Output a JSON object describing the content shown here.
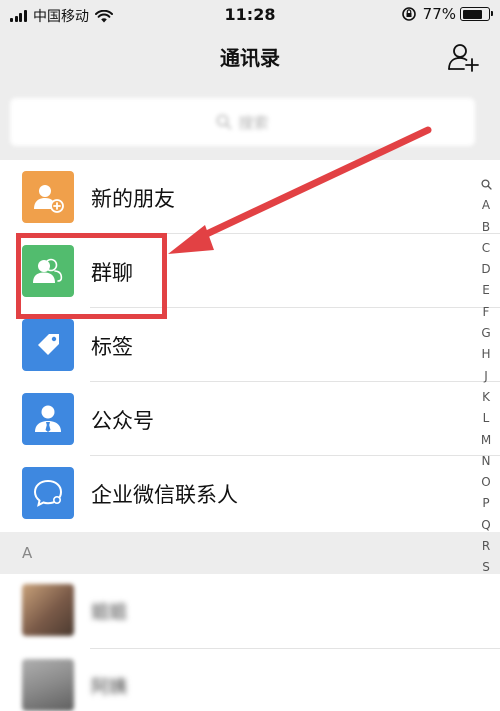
{
  "status_bar": {
    "carrier": "中国移动",
    "time": "11:28",
    "battery_text": "77%",
    "battery_level": 0.77
  },
  "nav": {
    "title": "通讯录",
    "add_icon": "add-contact-icon"
  },
  "search": {
    "placeholder": "搜索",
    "icon": "search-icon"
  },
  "menu_items": [
    {
      "label": "新的朋友",
      "icon": "new-friend-icon",
      "color": "#f0a04b"
    },
    {
      "label": "群聊",
      "icon": "group-chat-icon",
      "color": "#52bc6e"
    },
    {
      "label": "标签",
      "icon": "tag-icon",
      "color": "#3e88e0"
    },
    {
      "label": "公众号",
      "icon": "official-account-icon",
      "color": "#3e88e0"
    },
    {
      "label": "企业微信联系人",
      "icon": "work-contact-icon",
      "color": "#3e88e0"
    }
  ],
  "section": {
    "letter": "A"
  },
  "contacts": [
    {
      "name": "姐姐",
      "avatar_color": "#7a5a48"
    },
    {
      "name": "阿姨",
      "avatar_color": "#8a8a8a"
    }
  ],
  "index_bar": {
    "search_icon": "search-icon",
    "letters": [
      "A",
      "B",
      "C",
      "D",
      "E",
      "F",
      "G",
      "H",
      "J",
      "K",
      "L",
      "M",
      "N",
      "O",
      "P",
      "Q",
      "R",
      "S"
    ]
  },
  "annotation": {
    "color": "#e24144"
  }
}
